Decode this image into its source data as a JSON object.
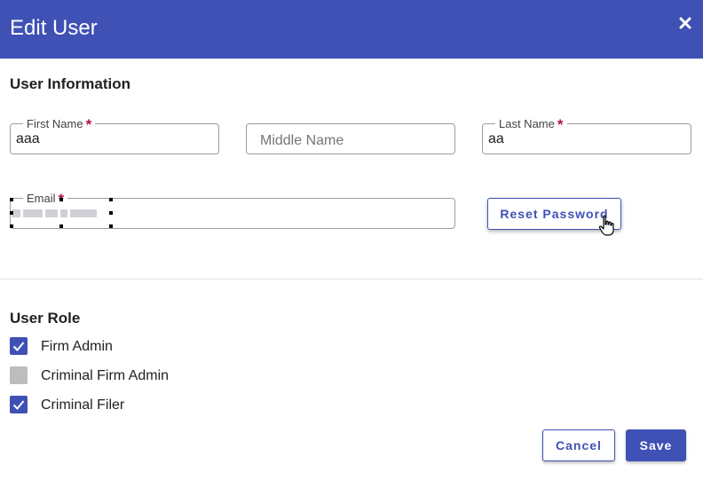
{
  "dialog": {
    "title": "Edit User",
    "close_icon": "close-icon"
  },
  "user_info": {
    "section_title": "User Information",
    "first_name": {
      "label": "First Name",
      "required_mark": "*",
      "value": "aaa"
    },
    "middle_name": {
      "placeholder": "Middle Name",
      "value": ""
    },
    "last_name": {
      "label": "Last Name",
      "required_mark": "*",
      "value": "aa"
    },
    "email": {
      "label": "Email",
      "required_mark": "*",
      "value_redacted": true
    },
    "reset_password_label": "Reset Password"
  },
  "user_role": {
    "section_title": "User Role",
    "roles": [
      {
        "label": "Firm Admin",
        "checked": true
      },
      {
        "label": "Criminal Firm Admin",
        "checked": false
      },
      {
        "label": "Criminal Filer",
        "checked": true
      }
    ]
  },
  "footer": {
    "cancel_label": "Cancel",
    "save_label": "Save"
  },
  "colors": {
    "primary": "#3f51b5",
    "required": "#b0163b",
    "checkbox_unchecked": "#bdbdbd"
  }
}
